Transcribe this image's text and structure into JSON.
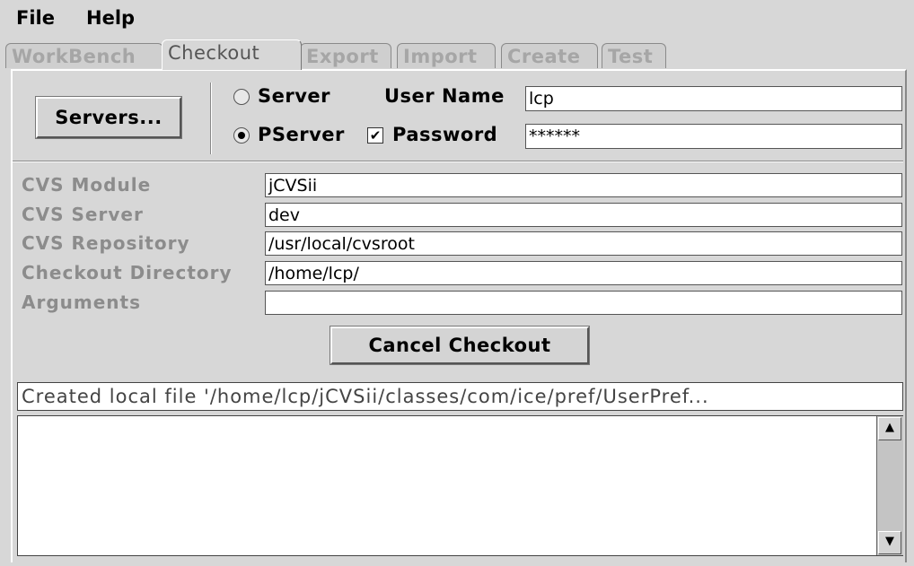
{
  "menu": {
    "file": "File",
    "help": "Help"
  },
  "tabs": [
    "WorkBench",
    "Checkout",
    "Export",
    "Import",
    "Create",
    "Test"
  ],
  "active_tab": "Checkout",
  "servers_button": "Servers...",
  "connection": {
    "server_label": "Server",
    "pserver_label": "PServer",
    "selected": "PServer",
    "user_name_label": "User Name",
    "user_name_value": "lcp",
    "password_label": "Password",
    "password_checked": true,
    "password_value": "******"
  },
  "form": {
    "cvs_module_label": "CVS Module",
    "cvs_module_value": "jCVSii",
    "cvs_server_label": "CVS Server",
    "cvs_server_value": "dev",
    "cvs_repository_label": "CVS Repository",
    "cvs_repository_value": "/usr/local/cvsroot",
    "checkout_directory_label": "Checkout Directory",
    "checkout_directory_value": "/home/lcp/",
    "arguments_label": "Arguments",
    "arguments_value": ""
  },
  "cancel_button": "Cancel Checkout",
  "status_text": "Created local file '/home/lcp/jCVSii/classes/com/ice/pref/UserPref...",
  "log_text": ""
}
